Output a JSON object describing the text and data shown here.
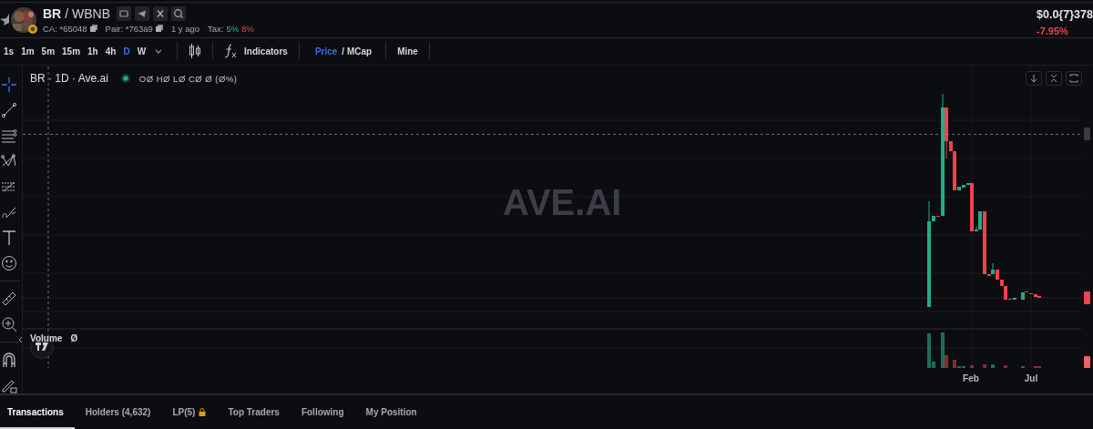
{
  "header": {
    "symbol": "BR",
    "quote": "/ WBNB",
    "ca": "CA: *65048",
    "pair": "Pair: *763a9",
    "age": "1 y ago",
    "tax_label": "Tax:",
    "buy_tax": "5%",
    "sell_tax": "8%",
    "price": "$0.0{7}378",
    "change": "-7.95%"
  },
  "intervals": [
    {
      "label": "1s",
      "selected": false
    },
    {
      "label": "1m",
      "selected": false
    },
    {
      "label": "5m",
      "selected": false
    },
    {
      "label": "15m",
      "selected": false
    },
    {
      "label": "1h",
      "selected": false
    },
    {
      "label": "4h",
      "selected": false
    },
    {
      "label": "D",
      "selected": true
    },
    {
      "label": "W",
      "selected": false
    }
  ],
  "indicators": "Indicators",
  "price_modes": [
    {
      "label": "Price",
      "selected": true
    },
    {
      "label": "/ MCap",
      "selected": false
    }
  ],
  "mine": "Mine",
  "legend": {
    "title": "BR · 1D · Ave.ai",
    "ohlc": "OØ HØ LØ CØ Ø (Ø%)"
  },
  "watermark": "AVE.AI",
  "volume": {
    "label": "Volume",
    "value": "Ø"
  },
  "x_labels": [
    "Feb",
    "Jul"
  ],
  "bottom_tabs": [
    {
      "label": "Transactions",
      "selected": true,
      "locked": false
    },
    {
      "label": "Holders (4,632)",
      "selected": false,
      "locked": false
    },
    {
      "label": "LP(5)",
      "selected": false,
      "locked": true
    },
    {
      "label": "Top Traders",
      "selected": false,
      "locked": false
    },
    {
      "label": "Following",
      "selected": false,
      "locked": false
    },
    {
      "label": "My Position",
      "selected": false,
      "locked": false
    }
  ]
}
